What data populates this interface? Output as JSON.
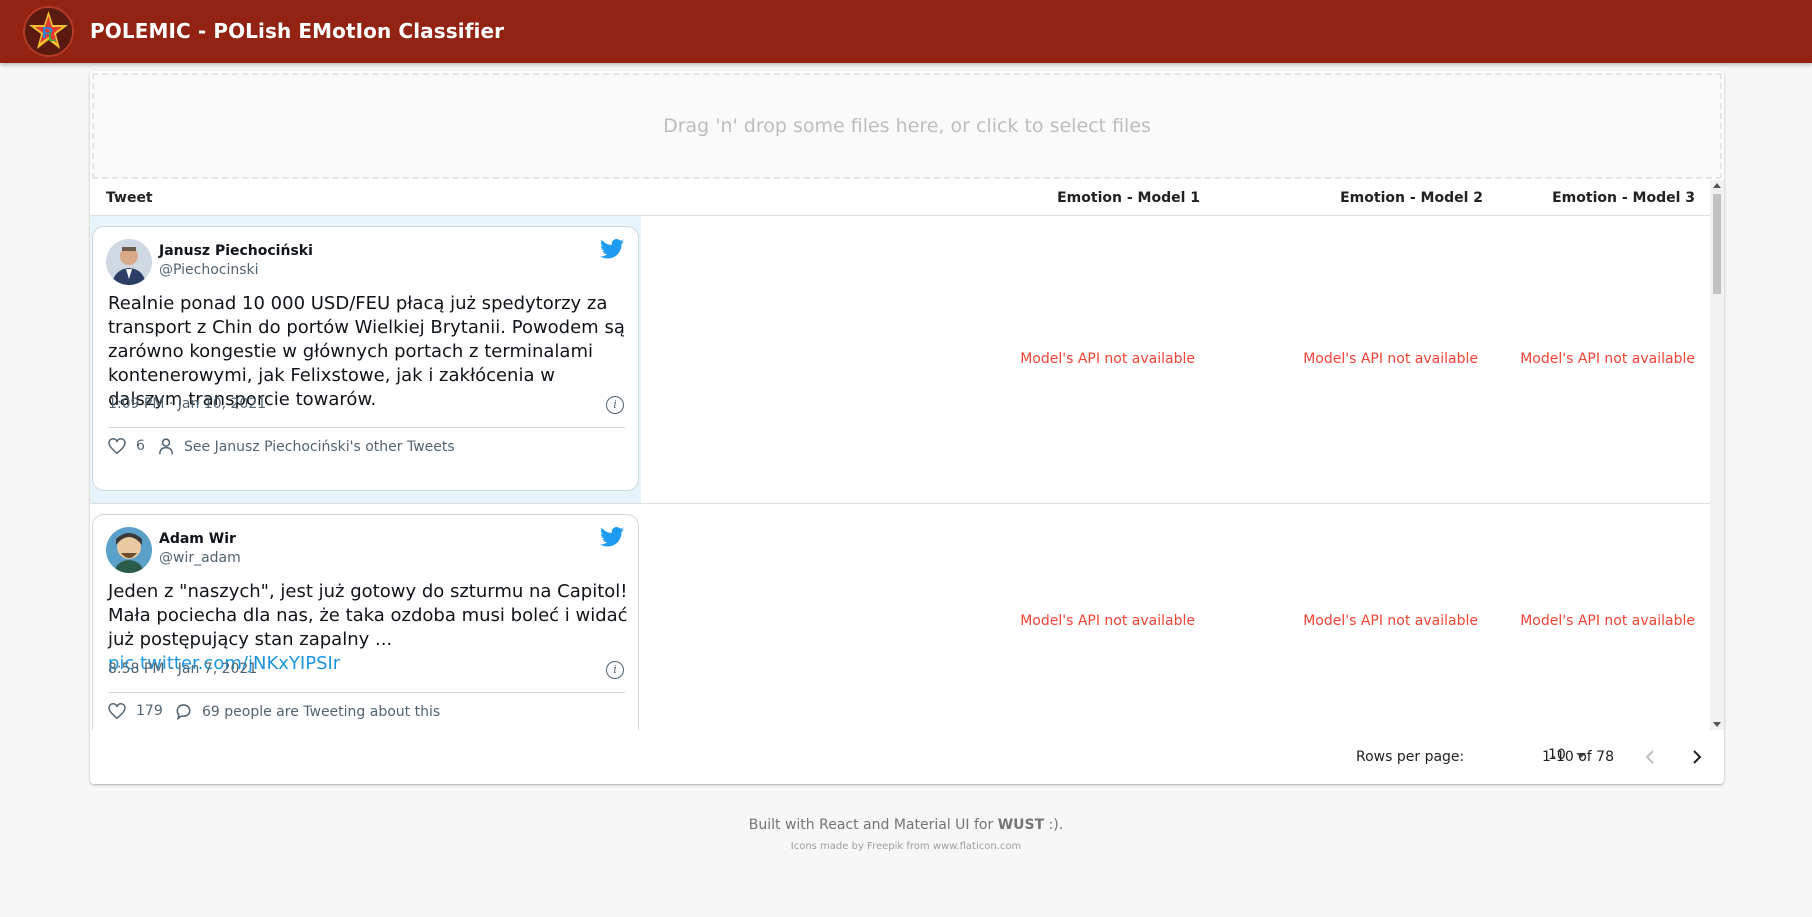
{
  "app": {
    "title": "POLEMIC - POLish EMotIon Classifier"
  },
  "dropzone": {
    "text": "Drag 'n' drop some files here, or click to select files"
  },
  "table": {
    "headers": [
      "Tweet",
      "Emotion - Model 1",
      "Emotion - Model 2",
      "Emotion - Model 3"
    ],
    "rows": [
      {
        "tweet": {
          "author": "Janusz Piechociński",
          "handle": "@Piechocinski",
          "text": "Realnie ponad 10 000 USD/FEU płacą już spedytorzy za transport z Chin do portów Wielkiej Brytanii. Powodem są zarówno kongestie w głównych portach z terminalami kontenerowymi, jak Felixstowe, jak i zakłócenia w dalszym transporcie towarów.",
          "link": "",
          "date": "1:09 PM · Jan 10, 2021",
          "likes": "6",
          "secondary_action": "See Janusz Piechociński's other Tweets"
        },
        "models": [
          "Model's API not available",
          "Model's API not available",
          "Model's API not available"
        ]
      },
      {
        "tweet": {
          "author": "Adam Wir",
          "handle": "@wir_adam",
          "text": "Jeden z \"naszych\", jest już gotowy do szturmu na Capitol! Mała pociecha dla nas, że taka ozdoba musi boleć i widać już postępujący stan zapalny ... ",
          "link": "pic.twitter.com/jNKxYIPSIr",
          "date": "8:58 PM · Jan 7, 2021",
          "likes": "179",
          "secondary_action": "69 people are Tweeting about this"
        },
        "models": [
          "Model's API not available",
          "Model's API not available",
          "Model's API not available"
        ]
      }
    ]
  },
  "pagination": {
    "rows_per_page_label": "Rows per page:",
    "rows_per_page_value": "10",
    "range": "1-10 of 78"
  },
  "footer": {
    "main_prefix": "Built with React and Material UI for ",
    "main_bold": "WUST",
    "main_suffix": " :).",
    "credits": "Icons made by Freepik from www.flaticon.com"
  },
  "colors": {
    "appbar": "#922312",
    "error": "#f44336",
    "twitter_blue": "#1d9bf0"
  },
  "icons": {
    "logo": "polemic-logo",
    "twitter": "twitter-bird-icon",
    "info": "info-icon",
    "like": "heart-icon",
    "profile": "person-icon",
    "reply": "speech-bubble-icon",
    "prev": "chevron-left-icon",
    "next": "chevron-right-icon",
    "select_arrow": "caret-down-icon"
  }
}
